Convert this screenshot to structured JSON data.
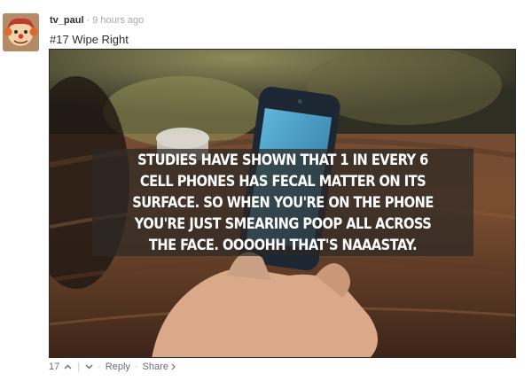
{
  "comment": {
    "username": "tv_paul",
    "separator": "·",
    "timestamp": "9 hours ago",
    "text": "#17 Wipe Right"
  },
  "image": {
    "overlay_text": "STUDIES HAVE SHOWN THAT 1 IN EVERY 6 CELL PHONES HAS FECAL MATTER ON ITS SURFACE. SO WHEN YOU'RE ON THE PHONE YOU'RE JUST SMEARING POOP ALL ACROSS THE FACE. OOOOHH THAT'S NAAASTAY."
  },
  "footer": {
    "vote_count": "17",
    "upvote_icon": "chevron-up-icon",
    "downvote_icon": "chevron-down-icon",
    "reply_label": "Reply",
    "share_label": "Share",
    "share_icon": "chevron-right-icon",
    "dot": "·",
    "pipe": "|"
  }
}
